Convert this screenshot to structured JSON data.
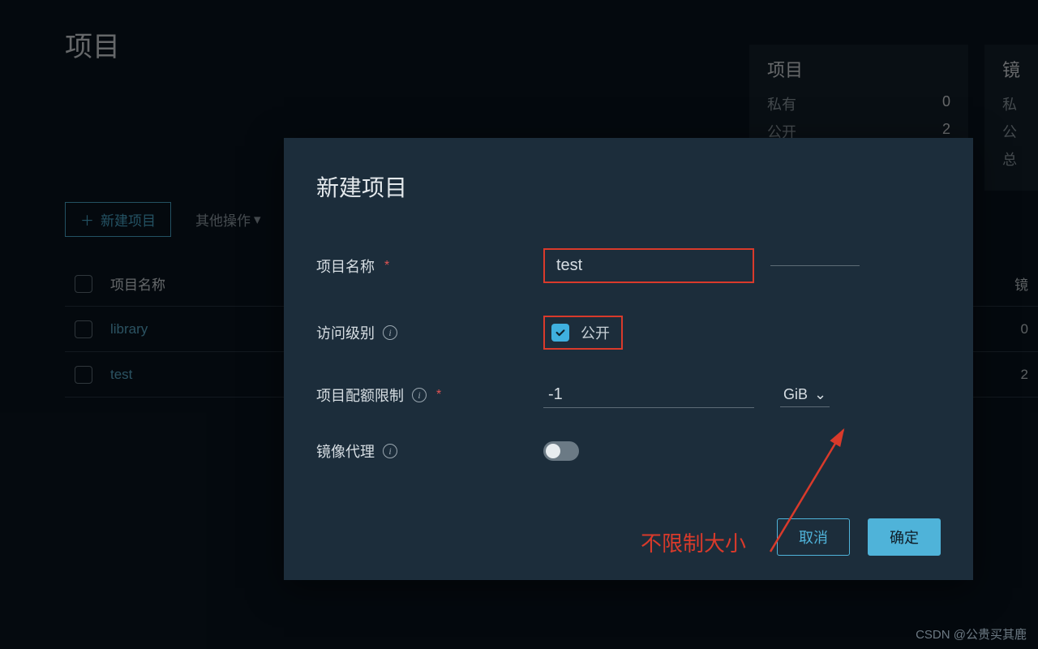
{
  "page": {
    "title": "项目",
    "watermark": "CSDN @公贵买其鹿"
  },
  "cards": {
    "project": {
      "title": "项目",
      "rows": [
        {
          "label": "私有",
          "value": "0"
        },
        {
          "label": "公开",
          "value": "2"
        }
      ]
    },
    "mirror": {
      "title": "镜",
      "rows": [
        {
          "label": "私",
          "value": ""
        },
        {
          "label": "公",
          "value": ""
        },
        {
          "label": "总",
          "value": ""
        }
      ]
    }
  },
  "toolbar": {
    "create_label": "新建项目",
    "other_label": "其他操作"
  },
  "table": {
    "header_name": "项目名称",
    "header_right": "镜",
    "rows": [
      {
        "name": "library",
        "right": "0"
      },
      {
        "name": "test",
        "right": "2"
      }
    ]
  },
  "modal": {
    "title": "新建项目",
    "fields": {
      "name_label": "项目名称",
      "name_value": "test",
      "access_label": "访问级别",
      "access_public_label": "公开",
      "quota_label": "项目配额限制",
      "quota_value": "-1",
      "quota_unit": "GiB",
      "proxy_label": "镜像代理"
    },
    "annotation": "不限制大小",
    "actions": {
      "cancel": "取消",
      "confirm": "确定"
    }
  }
}
